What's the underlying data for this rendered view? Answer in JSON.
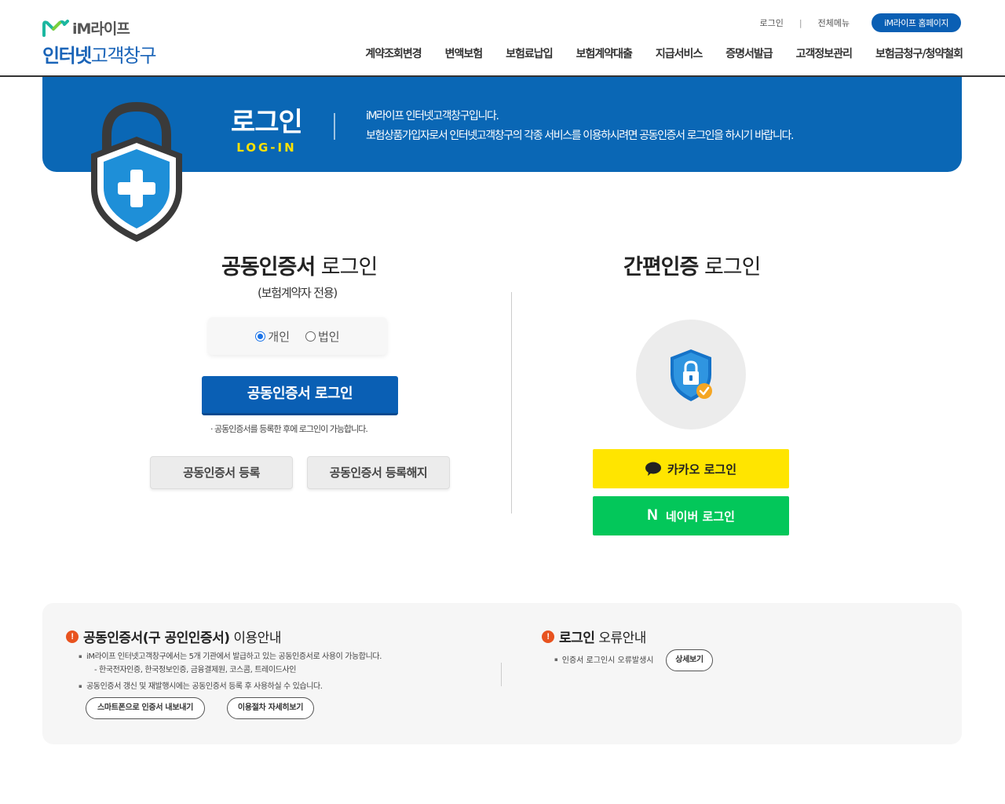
{
  "header": {
    "brand": "iM라이프",
    "title_bold": "인터넷",
    "title_thin": "고객창구",
    "util": {
      "login": "로그인",
      "sep": "|",
      "all_menu": "전체메뉴",
      "home": "iM라이프 홈페이지"
    },
    "gnb": [
      "계약조회변경",
      "변액보험",
      "보험료납입",
      "보험계약대출",
      "지급서비스",
      "증명서발급",
      "고객정보관리",
      "보험금청구/청약철회"
    ]
  },
  "banner": {
    "title_ko": "로그인",
    "title_en": "LOG-IN",
    "desc_line1": "iM라이프 인터넷고객창구입니다.",
    "desc_line2": "보험상품가입자로서 인터넷고객창구의 각종 서비스를 이용하시려면 공동인증서 로그인을 하시기 바랍니다."
  },
  "cert_login": {
    "title_bold": "공동인증서",
    "title_thin": " 로그인",
    "subtitle": "(보험계약자 전용)",
    "radio_personal": "개인",
    "radio_corporate": "법인",
    "selected": "개인",
    "login_button": "공동인증서 로그인",
    "note": "공동인증서를 등록한 후에 로그인이 가능합니다.",
    "register_button": "공동인증서 등록",
    "unregister_button": "공동인증서 등록해지"
  },
  "easy_login": {
    "title_bold": "간편인증",
    "title_thin": " 로그인",
    "kakao_button": "카카오 로그인",
    "naver_button": "네이버 로그인",
    "naver_letter": "N"
  },
  "info": {
    "left_title_bold": "공동인증서(구 공인인증서)",
    "left_title_thin": " 이용안내",
    "left_item1": "iM라이프 인터넷고객창구에서는 5개 기관에서 발급하고 있는 공동인증서로 사용이 가능합니다.",
    "left_item1_sub": "- 한국전자인증, 한국정보인증, 금융결제원, 코스콤, 트레이드사인",
    "left_item2": "공동인증서 갱신 및 재발행시에는 공동인증서 등록 후 사용하실 수 있습니다.",
    "smartphone_button": "스마트폰으로 인증서 내보내기",
    "procedure_button": "이용절차 자세히보기",
    "right_title_bold": "로그인",
    "right_title_thin": " 오류안내",
    "right_item": "인증서 로그인시 오류발생시",
    "detail_button": "상세보기",
    "warn_icon": "!"
  },
  "colors": {
    "primary_blue": "#0a5fb4",
    "banner_blue": "#0a67b5",
    "accent_yellow": "#ffe100",
    "kakao_yellow": "#ffe500",
    "naver_green": "#03c75a",
    "warn_orange": "#e8531f"
  }
}
